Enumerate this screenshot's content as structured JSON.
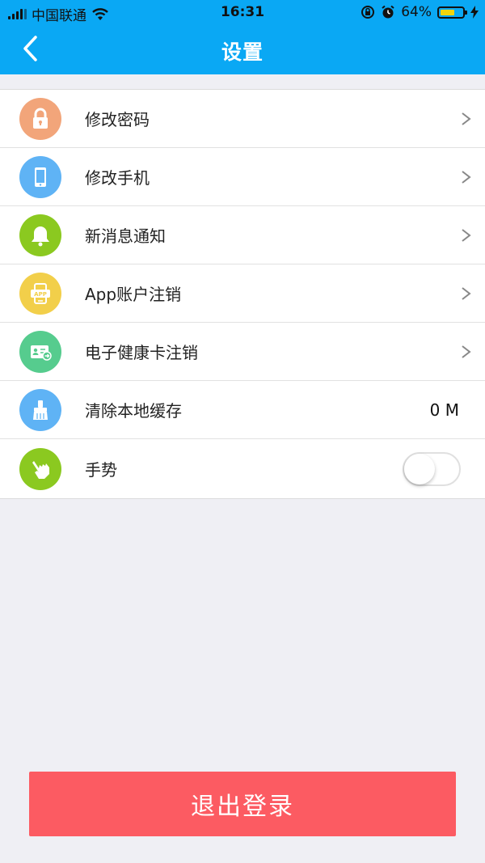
{
  "status_bar": {
    "carrier": "中国联通",
    "time": "16:31",
    "battery_percent": "64%",
    "battery_level": 0.64,
    "icons": [
      "signal-icon",
      "wifi-icon",
      "rotation-lock-icon",
      "alarm-icon",
      "battery-icon",
      "charging-icon"
    ]
  },
  "nav": {
    "title": "设置",
    "back_icon": "chevron-left-icon"
  },
  "settings": {
    "items": [
      {
        "label": "修改密码",
        "icon": "lock-icon",
        "color": "#f2a57a",
        "accessory": "chevron"
      },
      {
        "label": "修改手机",
        "icon": "phone-icon",
        "color": "#5fb3f5",
        "accessory": "chevron"
      },
      {
        "label": "新消息通知",
        "icon": "bell-icon",
        "color": "#8bc920",
        "accessory": "chevron"
      },
      {
        "label": "App账户注销",
        "icon": "app-phone-icon",
        "color": "#f2cf4a",
        "accessory": "chevron"
      },
      {
        "label": "电子健康卡注销",
        "icon": "health-card-icon",
        "color": "#56cc8e",
        "accessory": "chevron"
      },
      {
        "label": "清除本地缓存",
        "icon": "broom-icon",
        "color": "#5fb3f5",
        "accessory": "value",
        "value": "0 M"
      },
      {
        "label": "手势",
        "icon": "hand-gesture-icon",
        "color": "#8bc920",
        "accessory": "toggle",
        "toggle_on": false
      }
    ]
  },
  "logout_label": "退出登录",
  "colors": {
    "header": "#0aa8f4",
    "background": "#efeff4",
    "logout": "#fc5b62"
  }
}
